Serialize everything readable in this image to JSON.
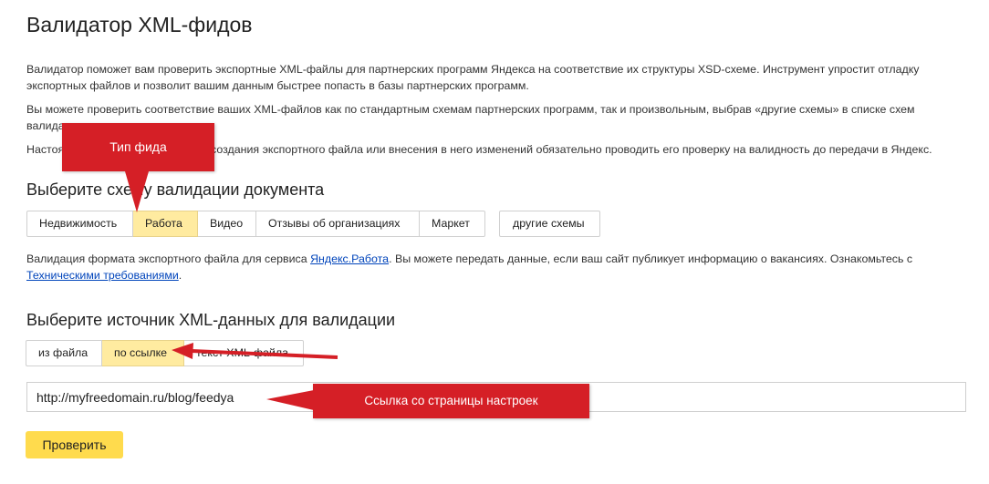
{
  "page": {
    "title": "Валидатор XML-фидов",
    "intro1": "Валидатор поможет вам проверить экспортные XML-файлы для партнерских программ Яндекса на соответствие их структуры XSD-схеме. Инструмент упростит отладку экспортных файлов и позволит вашим данным быстрее попасть в базы партнерских программ.",
    "intro2": "Вы можете проверить соответствие ваших XML-файлов как по стандартным схемам партнерских программ, так и произвольным, выбрав «другие схемы» в списке схем валидации.",
    "intro3": "Настоятельно рекомендуем после создания экспортного файла или внесения в него изменений обязательно проводить его проверку на валидность до передачи в Яндекс."
  },
  "schema_section": {
    "heading": "Выберите схему валидации документа",
    "tabs": [
      {
        "label": "Недвижимость",
        "active": false
      },
      {
        "label": "Работа",
        "active": true
      },
      {
        "label": "Видео",
        "active": false
      },
      {
        "label": "Отзывы об организациях",
        "active": false
      },
      {
        "label": "Маркет",
        "active": false
      }
    ],
    "other_schemes": "другие схемы",
    "desc_before": "Валидация формата экспортного файла для сервиса ",
    "desc_link": "Яндекс.Работа",
    "desc_middle": ". Вы можете передать данные, если ваш сайт публикует информацию о вакансиях. Ознакомьтесь с ",
    "desc_link2": "Техническими требованиями",
    "desc_after": "."
  },
  "source_section": {
    "heading": "Выберите источник XML-данных для валидации",
    "tabs": [
      {
        "label": "из файла",
        "active": false
      },
      {
        "label": "по ссылке",
        "active": true
      },
      {
        "label": "текст XML-файла",
        "active": false
      }
    ],
    "url_value": "http://myfreedomain.ru/blog/feedya",
    "submit_label": "Проверить"
  },
  "annotations": {
    "feed_type": "Тип фида",
    "link_note": "Ссылка со страницы настроек",
    "color": "#d51f26"
  },
  "colors": {
    "active_tab": "#ffeba0",
    "submit": "#ffdb4d",
    "link": "#0044bb"
  }
}
